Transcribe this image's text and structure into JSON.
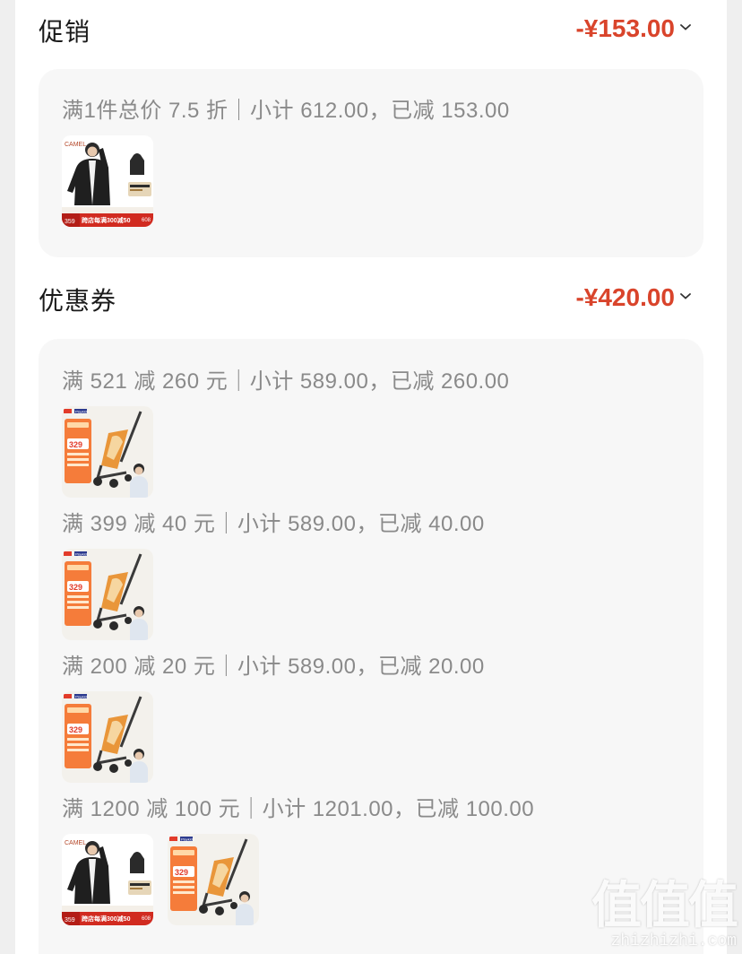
{
  "promotion": {
    "title": "促销",
    "amount": "-¥153.00",
    "rules": [
      {
        "text": "满1件总价 7.5 折｜小计 612.00，已减 153.00",
        "items": [
          "camel-jacket"
        ]
      }
    ]
  },
  "coupon": {
    "title": "优惠券",
    "amount": "-¥420.00",
    "rules": [
      {
        "text": "满 521 减 260 元｜小计 589.00，已减 260.00",
        "items": [
          "stroller"
        ]
      },
      {
        "text": "满 399 减 40 元｜小计 589.00，已减 40.00",
        "items": [
          "stroller"
        ]
      },
      {
        "text": "满 200 减 20 元｜小计 589.00，已减 20.00",
        "items": [
          "stroller"
        ]
      },
      {
        "text": "满 1200 减 100 元｜小计 1201.00，已减 100.00",
        "items": [
          "camel-jacket",
          "stroller"
        ]
      }
    ]
  },
  "jacket_thumb": {
    "brand": "CAMEL",
    "price": "359",
    "banner": "跨店每满300减50",
    "badge": "608"
  },
  "stroller_thumb": {
    "price": "329",
    "brand": "Playkids"
  },
  "watermark": {
    "logo": "值值值",
    "url": "zhizhizhi.com"
  },
  "colors": {
    "accent": "#d9442b",
    "card_bg": "#f7f7f7",
    "page_bg": "#ffffff"
  }
}
